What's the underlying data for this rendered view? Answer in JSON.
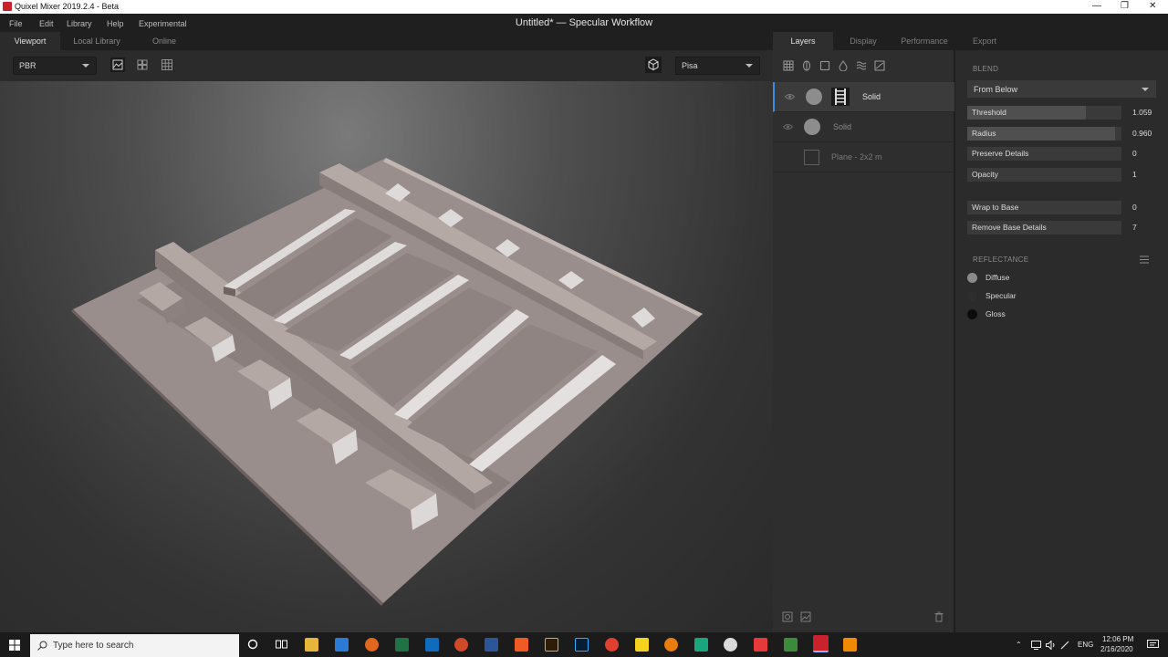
{
  "window": {
    "app_title": "Quixel Mixer 2019.2.4 - Beta",
    "doc_title": "Untitled* — Specular Workflow",
    "controls": {
      "minimize": "—",
      "maximize": "❐",
      "close": "✕"
    }
  },
  "menu": [
    "File",
    "Edit",
    "Library",
    "Help",
    "Experimental"
  ],
  "viewport_tabs": [
    "Viewport",
    "Local Library",
    "Online"
  ],
  "viewport_toolbar": {
    "render_mode": "PBR",
    "environment": "Pisa",
    "icons": [
      "image-view-icon",
      "grid-2x2-icon",
      "grid-3x3-icon",
      "cube-icon"
    ]
  },
  "right_tabs": [
    "Layers",
    "Display",
    "Performance",
    "Export"
  ],
  "layers": [
    {
      "name": "Solid",
      "selected": true,
      "visible": true
    },
    {
      "name": "Solid",
      "selected": false,
      "visible": true
    },
    {
      "name": "Plane - 2x2 m",
      "selected": false,
      "visible": false
    }
  ],
  "blend": {
    "header": "BLEND",
    "mode": "From Below",
    "props": [
      {
        "label": "Threshold",
        "value": "1.059",
        "fill": 0.77
      },
      {
        "label": "Radius",
        "value": "0.960",
        "fill": 0.96
      },
      {
        "label": "Preserve Details",
        "value": "0",
        "fill": 0
      },
      {
        "label": "Opacity",
        "value": "1",
        "fill": 0
      }
    ],
    "extra": [
      {
        "label": "Wrap to Base",
        "value": "0"
      },
      {
        "label": "Remove Base Details",
        "value": "7"
      }
    ]
  },
  "reflectance": {
    "header": "REFLECTANCE",
    "items": [
      {
        "label": "Diffuse",
        "color": "#8a8a8a"
      },
      {
        "label": "Specular",
        "color": "#2e2e2e"
      },
      {
        "label": "Gloss",
        "color": "#0c0c0c"
      }
    ]
  },
  "taskbar": {
    "search_placeholder": "Type here to search",
    "lang": "ENG",
    "time": "12:06 PM",
    "date": "2/16/2020"
  },
  "colors": {
    "accent": "#3d8ee0",
    "surface": "#a69896"
  }
}
